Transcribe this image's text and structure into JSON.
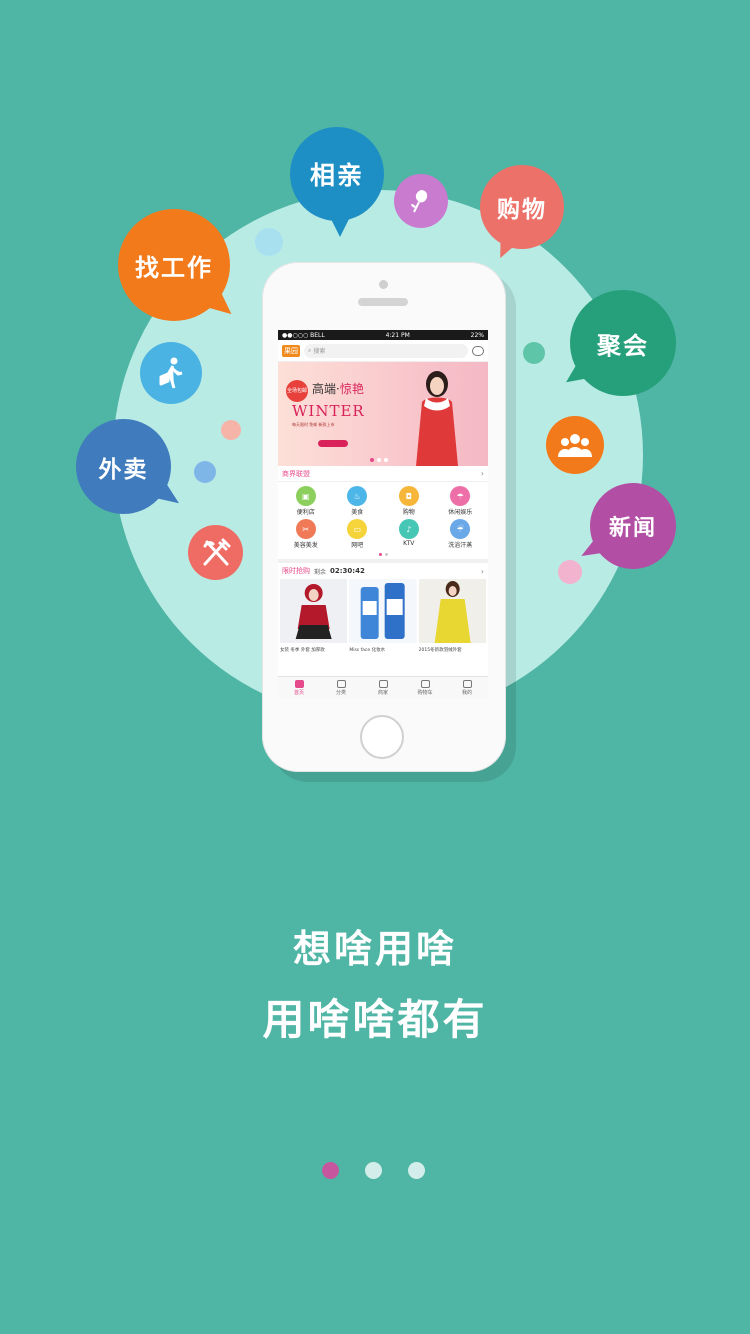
{
  "colors": {
    "background": "#4fb5a4",
    "circle": "#b9ebe5",
    "accent_pink": "#e64a8a",
    "pager_active": "#c6579f"
  },
  "bubbles": {
    "find_job": "找工作",
    "dating": "相亲",
    "shopping": "购物",
    "party": "聚会",
    "takeout": "外卖",
    "news": "新闻"
  },
  "icons": [
    "walking-person-icon",
    "rose-icon",
    "people-group-icon",
    "fork-knife-icon"
  ],
  "app": {
    "status": {
      "carrier": "●●○○○ BELL",
      "time": "4:21 PM",
      "battery": "22%"
    },
    "logo": "果园",
    "search_placeholder": "搜索",
    "banner": {
      "badge": "全场包邮",
      "headline_a": "高端·",
      "headline_b": "惊艳",
      "winter": "WINTER",
      "fine_print": "每天限时 免邮 新款上市"
    },
    "merchant_title": "商界联盟",
    "categories": [
      {
        "label": "便利店",
        "icon": "store-icon",
        "color": "#8ccf5c"
      },
      {
        "label": "美食",
        "icon": "food-icon",
        "color": "#4cb6e8"
      },
      {
        "label": "购物",
        "icon": "bag-icon",
        "color": "#f6b63a"
      },
      {
        "label": "休闲娱乐",
        "icon": "umbrella-icon",
        "color": "#ee6fa8"
      },
      {
        "label": "美容美发",
        "icon": "hair-icon",
        "color": "#f07a57"
      },
      {
        "label": "网吧",
        "icon": "monitor-icon",
        "color": "#f5d33a"
      },
      {
        "label": "KTV",
        "icon": "mic-icon",
        "color": "#46c7b6"
      },
      {
        "label": "洗浴汗蒸",
        "icon": "shower-icon",
        "color": "#6aa8e8"
      }
    ],
    "flash": {
      "title": "限时抢购",
      "remaining_label": "剩余",
      "countdown": "02:30:42"
    },
    "products": [
      {
        "caption": "女装 冬季 外套 加厚款"
      },
      {
        "caption": "Miss face 化妆水"
      },
      {
        "caption": "2015冬新款羽绒外套"
      }
    ],
    "tabs": [
      "首页",
      "分类",
      "商家",
      "购物车",
      "我的"
    ]
  },
  "slogan": {
    "line1": "想啥用啥",
    "line2": "用啥啥都有"
  },
  "pager": {
    "count": 3,
    "active": 0
  }
}
